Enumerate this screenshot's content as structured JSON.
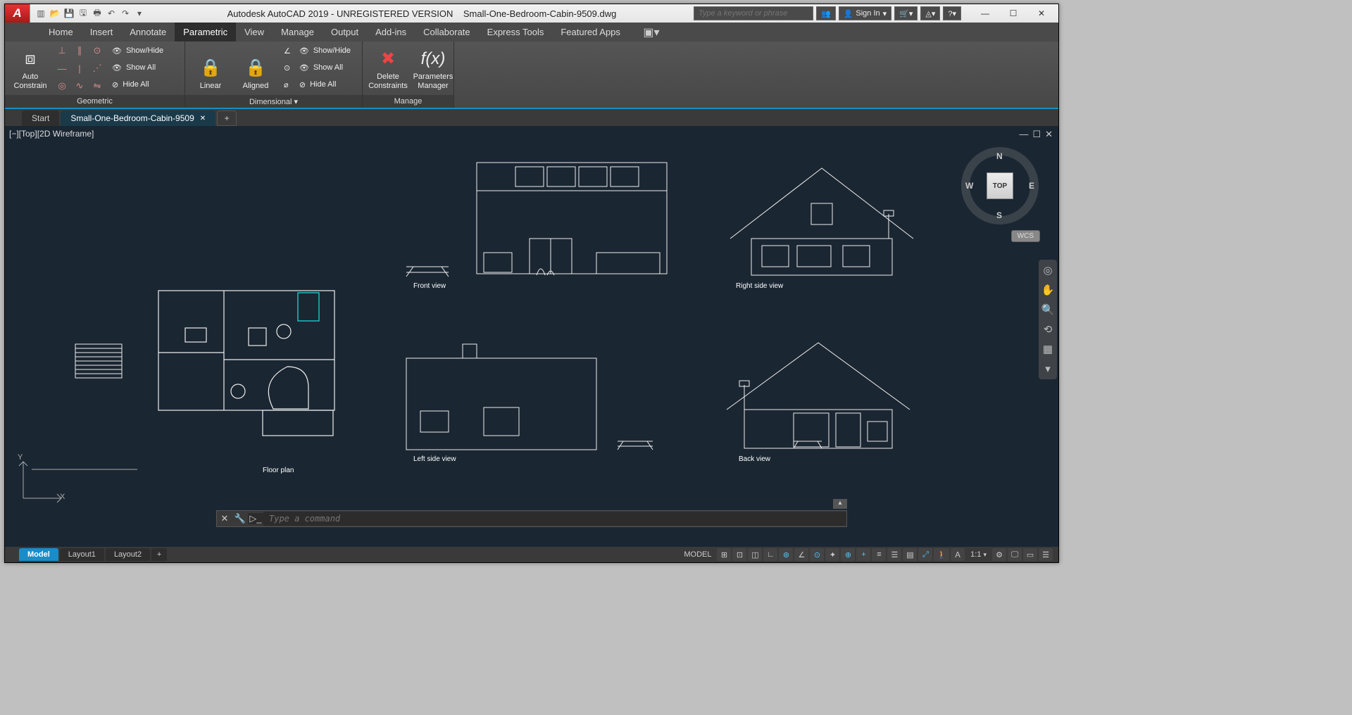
{
  "title": {
    "app": "Autodesk AutoCAD 2019 - UNREGISTERED VERSION",
    "file": "Small-One-Bedroom-Cabin-9509.dwg"
  },
  "search_placeholder": "Type a keyword or phrase",
  "signin": "Sign In",
  "menus": [
    "Home",
    "Insert",
    "Annotate",
    "Parametric",
    "View",
    "Manage",
    "Output",
    "Add-ins",
    "Collaborate",
    "Express Tools",
    "Featured Apps"
  ],
  "active_menu": 3,
  "ribbon": {
    "panels": [
      {
        "title": "Geometric",
        "big": [
          {
            "label": "Auto\nConstrain"
          }
        ],
        "rows": [
          [
            "Show/Hide",
            "Show All",
            "Hide All"
          ]
        ]
      },
      {
        "title": "Dimensional ▾",
        "big": [
          {
            "label": "Linear"
          },
          {
            "label": "Aligned"
          }
        ],
        "rows": [
          [
            "Show/Hide",
            "Show All",
            "Hide All"
          ]
        ]
      },
      {
        "title": "Manage",
        "big": [
          {
            "label": "Delete\nConstraints"
          },
          {
            "label": "Parameters\nManager"
          }
        ]
      }
    ]
  },
  "filetabs": [
    {
      "label": "Start",
      "active": false
    },
    {
      "label": "Small-One-Bedroom-Cabin-9509",
      "active": true
    }
  ],
  "viewport_label": "[−][Top][2D Wireframe]",
  "viewcube": {
    "face": "TOP",
    "n": "N",
    "s": "S",
    "e": "E",
    "w": "W",
    "wcs": "WCS"
  },
  "drawings": {
    "floor": "Floor plan",
    "front": "Front view",
    "right": "Right side view",
    "left": "Left side view",
    "back": "Back view"
  },
  "ucs": {
    "x": "X",
    "y": "Y"
  },
  "cmd_placeholder": "Type a command",
  "layout_tabs": [
    "Model",
    "Layout1",
    "Layout2"
  ],
  "active_layout": 0,
  "status": {
    "model": "MODEL",
    "scale": "1:1"
  }
}
